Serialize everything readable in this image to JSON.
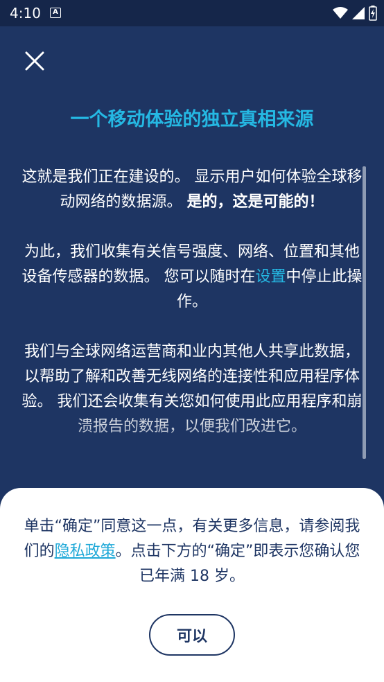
{
  "status_bar": {
    "time": "4:10",
    "notif_letter": "A"
  },
  "header": {
    "title": "一个移动体验的独立真相来源"
  },
  "content": {
    "p1_text": "这就是我们正在建设的。 显示用户如何体验全球移动网络的数据源。",
    "p1_bold": "是的，这是可能的！",
    "p2_before": "为此，我们收集有关信号强度、网络、位置和其他设备传感器的数据。 您可以随时在",
    "p2_link": "设置",
    "p2_after": "中停止此操作。",
    "p3_text": "我们与全球网络运营商和业内其他人共享此数据，以帮助了解和改善无线网络的连接性和应用程序体验。 我们还会收集有关您如何使用此应用程序和崩溃报告的数据，以便我们改进它。"
  },
  "sheet": {
    "text_before": "单击“确定”同意这一点，有关更多信息，请参阅我们的",
    "link": "隐私政策",
    "text_after": "。点击下方的“确定”即表示您确认您已年满 18 岁。",
    "ok_label": "可以"
  },
  "colors": {
    "background": "#1e3563",
    "accent": "#25b8e3",
    "sheet": "#ffffff"
  }
}
